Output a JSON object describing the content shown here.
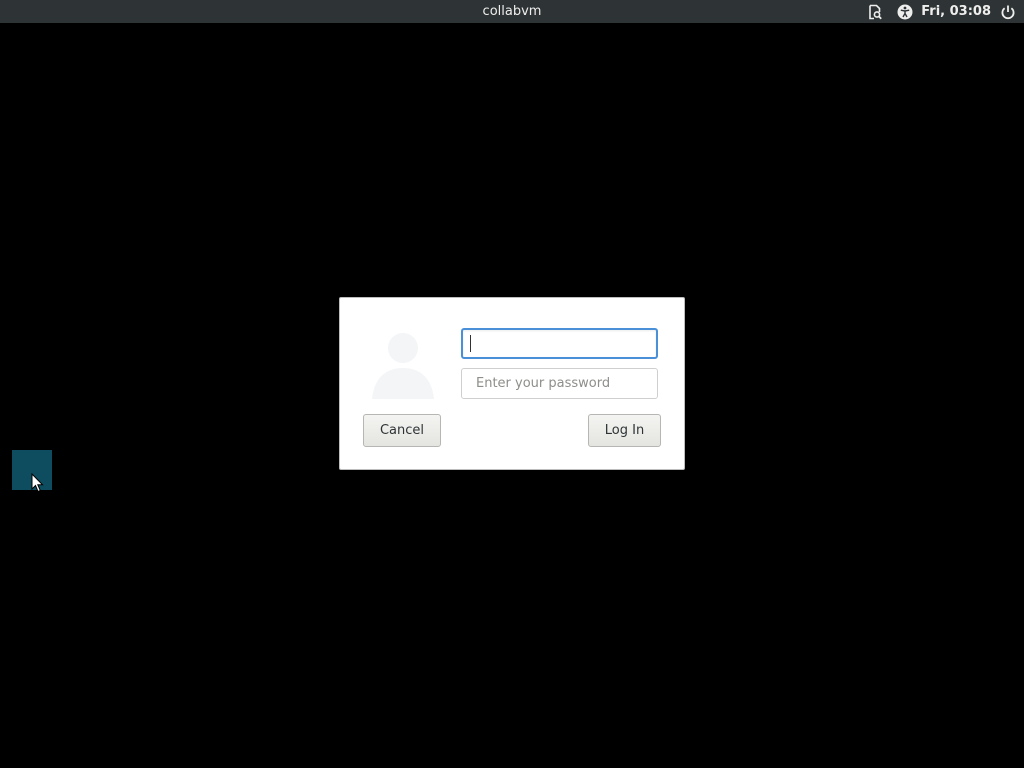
{
  "topbar": {
    "hostname": "collabvm",
    "clock": "Fri, 03:08",
    "icons": [
      "document-search-icon",
      "accessibility-icon",
      "power-icon"
    ]
  },
  "login_dialog": {
    "username": {
      "value": "",
      "placeholder": ""
    },
    "password": {
      "value": "",
      "placeholder": "Enter your password"
    },
    "cancel_label": "Cancel",
    "login_label": "Log In"
  },
  "colors": {
    "topbar": "#2e3436",
    "background": "#000000",
    "focus": "#4a90d9",
    "desktop_tile": "#0d4d5f"
  }
}
